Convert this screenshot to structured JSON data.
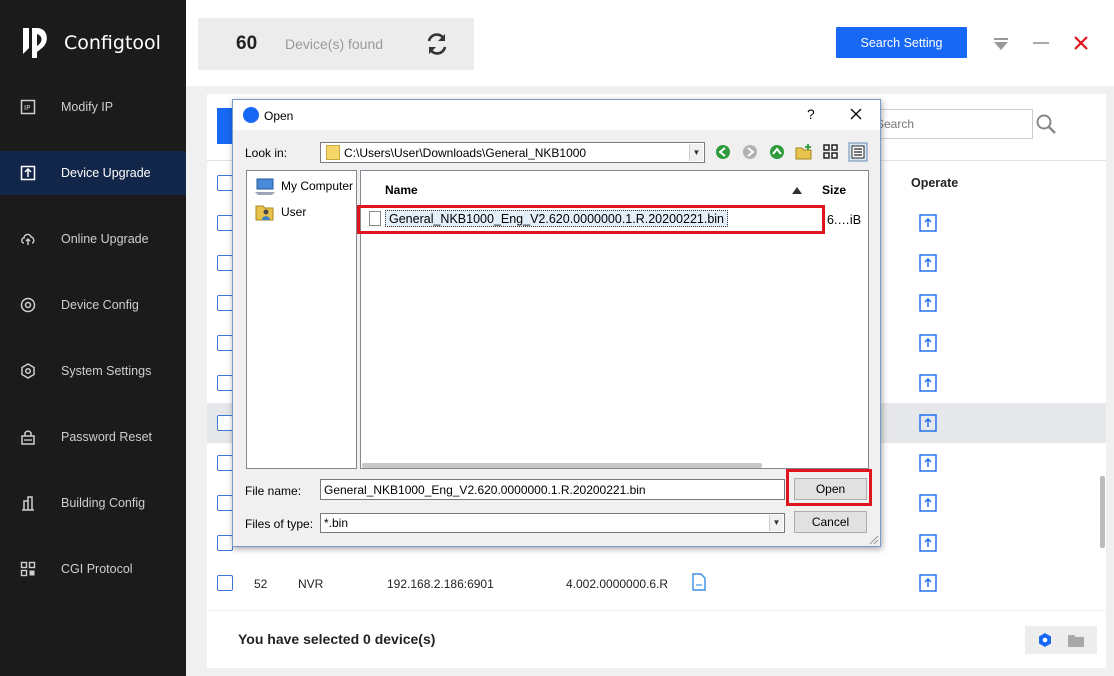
{
  "app": {
    "name": "Configtool"
  },
  "sidebar": {
    "items": [
      {
        "label": "Modify IP",
        "icon": "modify-ip-icon",
        "active": false
      },
      {
        "label": "Device Upgrade",
        "icon": "device-upgrade-icon",
        "active": true
      },
      {
        "label": "Online Upgrade",
        "icon": "cloud-upload-icon",
        "active": false
      },
      {
        "label": "Device Config",
        "icon": "device-config-icon",
        "active": false
      },
      {
        "label": "System Settings",
        "icon": "system-settings-icon",
        "active": false
      },
      {
        "label": "Password Reset",
        "icon": "password-reset-icon",
        "active": false
      },
      {
        "label": "Building Config",
        "icon": "building-config-icon",
        "active": false
      },
      {
        "label": "CGI Protocol",
        "icon": "cgi-protocol-icon",
        "active": false
      }
    ]
  },
  "topbar": {
    "device_count": "60",
    "device_count_label": "Device(s) found",
    "search_setting_label": "Search Setting"
  },
  "main": {
    "search_placeholder": "Search",
    "operate_header": "Operate",
    "last_row": {
      "no": "52",
      "type": "NVR",
      "ip": "192.168.2.186:6901",
      "version": "4.002.0000000.6.R"
    }
  },
  "footer": {
    "selected_text": "You have selected 0  device(s)"
  },
  "dialog": {
    "title": "Open",
    "help": "?",
    "look_in_label": "Look in:",
    "look_in_path": "C:\\Users\\User\\Downloads\\General_NKB1000",
    "places": [
      {
        "label": "My Computer",
        "icon": "my-computer-icon"
      },
      {
        "label": "User",
        "icon": "user-folder-icon"
      }
    ],
    "columns": {
      "name": "Name",
      "size": "Size"
    },
    "file": {
      "name": "General_NKB1000_Eng_V2.620.0000000.1.R.20200221.bin",
      "size": "6.…iB"
    },
    "file_name_label": "File name:",
    "file_name_value": "General_NKB1000_Eng_V2.620.0000000.1.R.20200221.bin",
    "files_of_type_label": "Files of type:",
    "files_of_type_value": "*.bin",
    "open_label": "Open",
    "cancel_label": "Cancel"
  },
  "colors": {
    "accent": "#1768f4",
    "sidebar_bg": "#1b1b1b",
    "active_nav": "#12264a",
    "highlight": "#e0141e"
  }
}
